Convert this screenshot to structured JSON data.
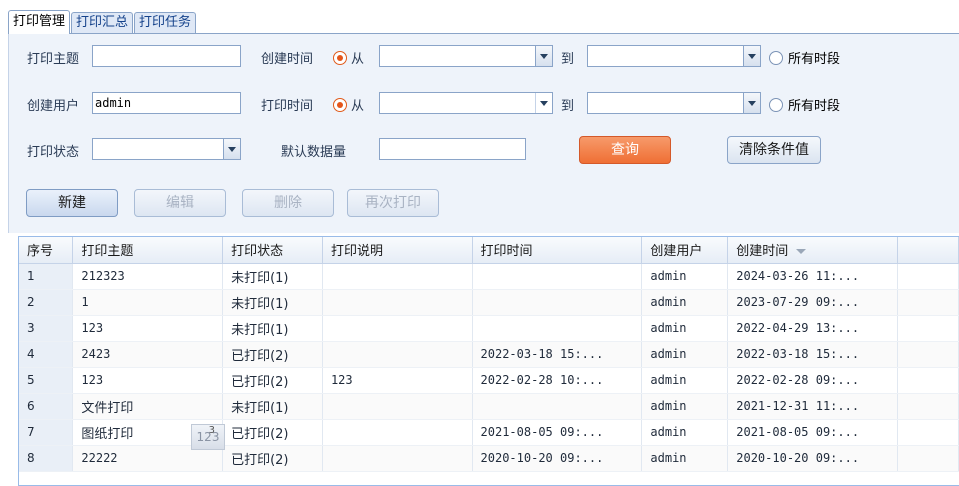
{
  "tabs": [
    "打印管理",
    "打印汇总",
    "打印任务"
  ],
  "filters": {
    "subject_label": "打印主题",
    "subject_value": "",
    "create_time_label": "创建时间",
    "from_label": "从",
    "to_label": "到",
    "all_periods_label": "所有时段",
    "creator_label": "创建用户",
    "creator_value": "admin",
    "print_time_label": "打印时间",
    "status_label": "打印状态",
    "status_value": "",
    "default_count_label": "默认数据量",
    "default_count_value": ""
  },
  "buttons": {
    "query": "查询",
    "clear": "清除条件值",
    "new": "新建",
    "edit": "编辑",
    "delete": "删除",
    "reprint": "再次打印"
  },
  "grid": {
    "columns": [
      "序号",
      "打印主题",
      "打印状态",
      "打印说明",
      "打印时间",
      "创建用户",
      "创建时间"
    ],
    "rows": [
      [
        "1",
        "212323",
        "未打印(1)",
        "",
        "",
        "admin",
        "2024-03-26 11:..."
      ],
      [
        "2",
        "1",
        "未打印(1)",
        "",
        "",
        "admin",
        "2023-07-29 09:..."
      ],
      [
        "3",
        "123",
        "未打印(1)",
        "",
        "",
        "admin",
        "2022-04-29 13:..."
      ],
      [
        "4",
        "2423",
        "已打印(2)",
        "",
        "2022-03-18 15:...",
        "admin",
        "2022-03-18 15:..."
      ],
      [
        "5",
        "123",
        "已打印(2)",
        "123",
        "2022-02-28 10:...",
        "admin",
        "2022-02-28 09:..."
      ],
      [
        "6",
        "文件打印",
        "未打印(1)",
        "",
        "",
        "admin",
        "2021-12-31 11:..."
      ],
      [
        "7",
        "图纸打印",
        "已打印(2)",
        "",
        "2021-08-05 09:...",
        "admin",
        "2021-08-05 09:..."
      ],
      [
        "8",
        "22222",
        "已打印(2)",
        "",
        "2020-10-20 09:...",
        "admin",
        "2020-10-20 09:..."
      ]
    ]
  },
  "drag_thumb": {
    "label": "123",
    "pin": "3"
  }
}
